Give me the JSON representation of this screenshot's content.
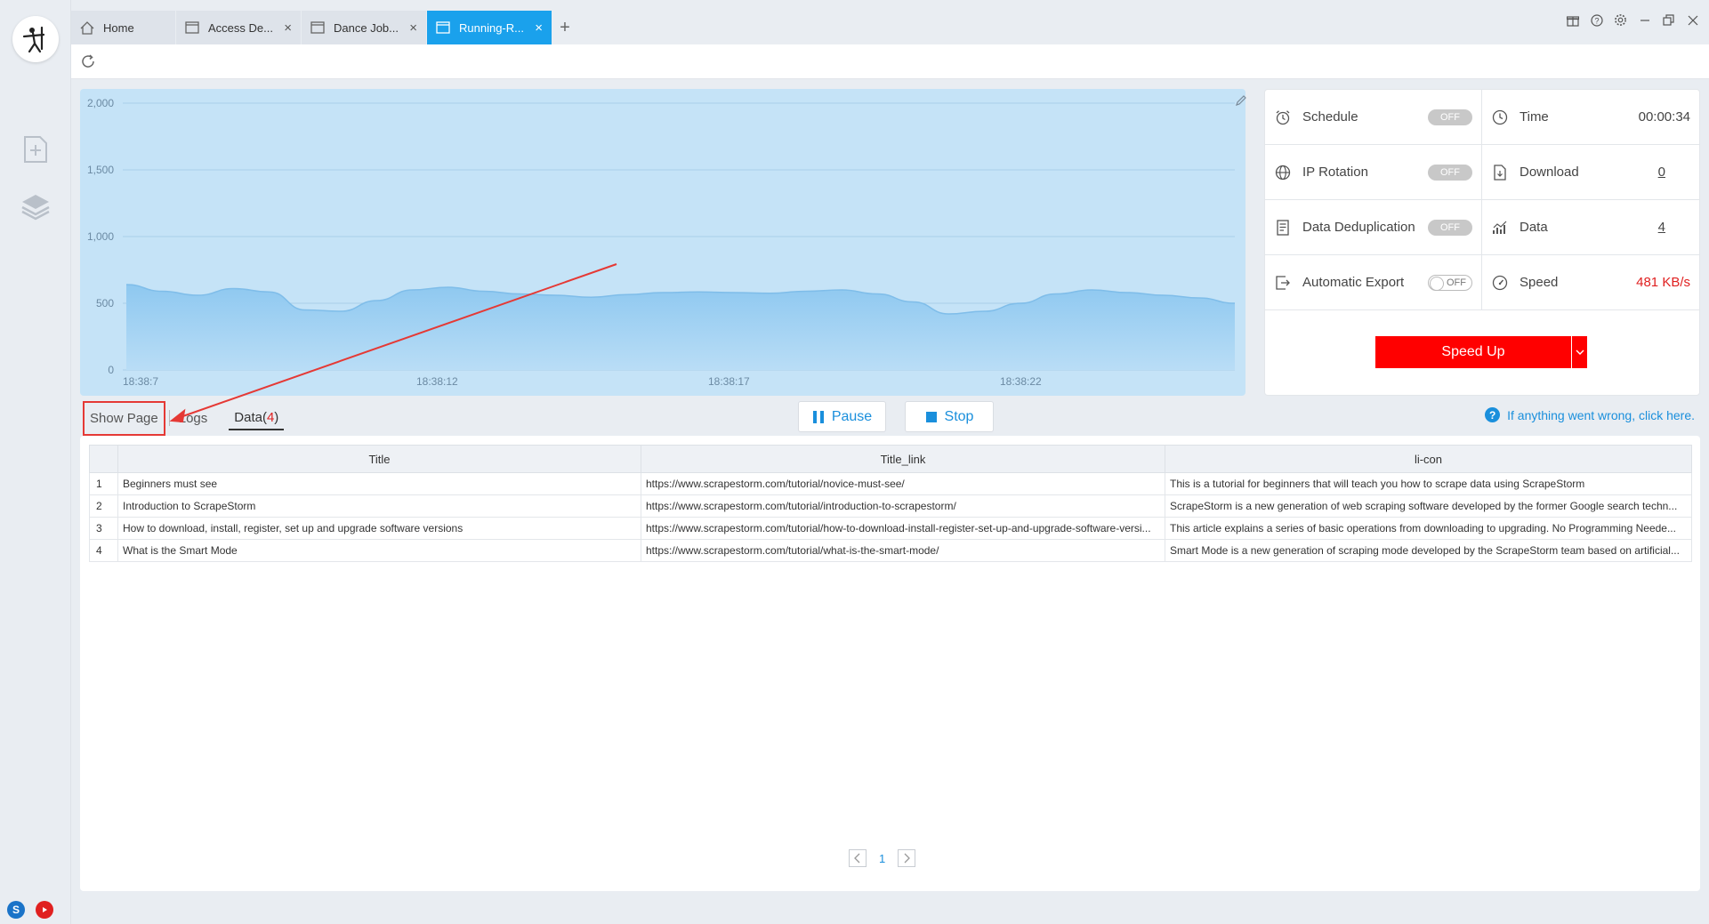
{
  "tabs": [
    {
      "label": "Home",
      "icon": "home-icon"
    },
    {
      "label": "Access De...",
      "icon": "window-icon"
    },
    {
      "label": "Dance Job...",
      "icon": "window-icon"
    },
    {
      "label": "Running-R...",
      "icon": "window-icon"
    }
  ],
  "tab_close": "×",
  "tab_add": "+",
  "colors": {
    "accent": "#1aa1ec",
    "red": "#ff0000",
    "chart_fill": "#c5e3f7",
    "link": "#1a8fdc"
  },
  "chart_data": {
    "type": "area",
    "y_ticks": [
      "2,000",
      "1,500",
      "1,000",
      "500",
      "0"
    ],
    "x_ticks": [
      "18:38:7",
      "18:38:12",
      "18:38:17",
      "18:38:22"
    ],
    "ylim": [
      0,
      2000
    ],
    "grid": true,
    "values": [
      640,
      590,
      560,
      610,
      585,
      450,
      440,
      520,
      600,
      620,
      590,
      570,
      560,
      545,
      565,
      580,
      585,
      580,
      575,
      590,
      600,
      570,
      510,
      420,
      440,
      500,
      570,
      600,
      580,
      560,
      540,
      500
    ]
  },
  "stats": {
    "schedule": {
      "label": "Schedule",
      "state": "OFF"
    },
    "ip_rotation": {
      "label": "IP Rotation",
      "state": "OFF"
    },
    "dedup": {
      "label": "Data Deduplication",
      "state": "OFF"
    },
    "auto_export": {
      "label": "Automatic Export",
      "state": "OFF"
    },
    "time": {
      "label": "Time",
      "value": "00:00:34"
    },
    "download": {
      "label": "Download",
      "value": "0"
    },
    "data": {
      "label": "Data",
      "value": "4"
    },
    "speed": {
      "label": "Speed",
      "value": "481 KB/s"
    }
  },
  "speed_up": "Speed Up",
  "subtabs": {
    "show_page": "Show Page",
    "logs": "Logs",
    "data": "Data(",
    "data_count": "4",
    "data_close": ")"
  },
  "buttons": {
    "pause": "Pause",
    "stop": "Stop"
  },
  "help_text": "If anything went wrong, click here.",
  "table": {
    "columns": [
      "",
      "Title",
      "Title_link",
      "li-con"
    ],
    "rows": [
      [
        "1",
        "Beginners must see",
        "https://www.scrapestorm.com/tutorial/novice-must-see/",
        "This is a tutorial for beginners that will teach you how to scrape data using ScrapeStorm"
      ],
      [
        "2",
        "Introduction to ScrapeStorm",
        "https://www.scrapestorm.com/tutorial/introduction-to-scrapestorm/",
        "ScrapeStorm is a new generation of web scraping software developed by the former Google search techn..."
      ],
      [
        "3",
        "How to download, install, register, set up and upgrade software versions",
        "https://www.scrapestorm.com/tutorial/how-to-download-install-register-set-up-and-upgrade-software-versi...",
        "This article explains a series of basic operations from downloading to upgrading. No Programming Neede..."
      ],
      [
        "4",
        "What is the Smart Mode",
        "https://www.scrapestorm.com/tutorial/what-is-the-smart-mode/",
        "Smart Mode is a new generation of scraping mode developed by the ScrapeStorm team based on artificial..."
      ]
    ]
  },
  "pager": {
    "page": "1"
  }
}
